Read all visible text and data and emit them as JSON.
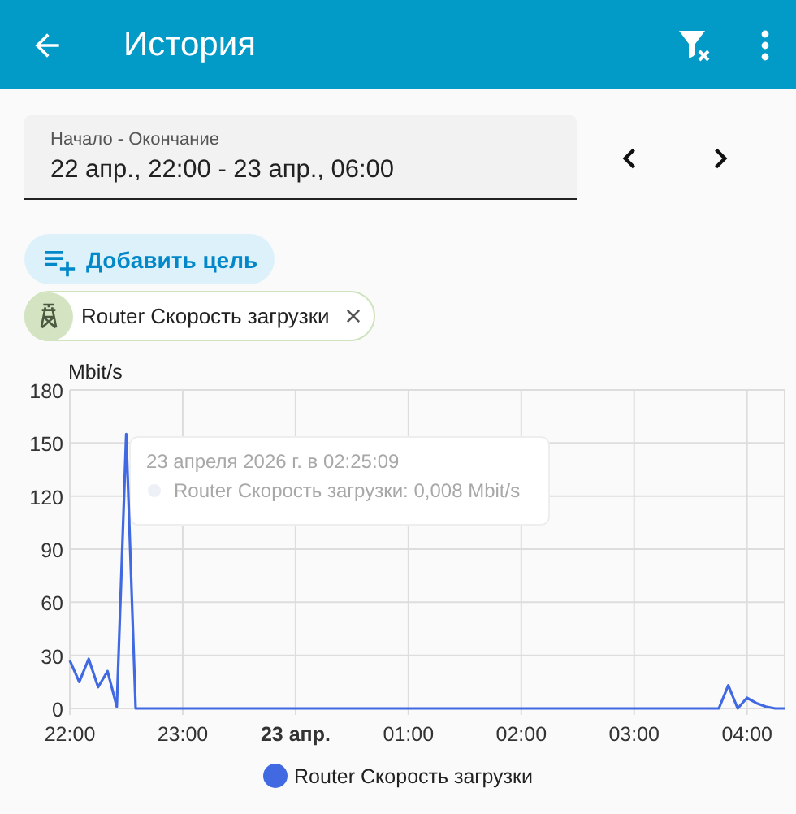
{
  "app_bar": {
    "title": "История"
  },
  "date_range": {
    "label": "Начало - Окончание",
    "value": "22 апр., 22:00 - 23 апр., 06:00"
  },
  "add_target_button": {
    "label": "Добавить цель"
  },
  "targets": [
    {
      "label": "Router Скорость загрузки"
    }
  ],
  "chart": {
    "tooltip": {
      "title": "23 апреля 2026 г. в 02:25:09",
      "line": "Router Скорость загрузки: 0,008 Mbit/s"
    },
    "chart_data": {
      "type": "line",
      "ylabel": "Mbit/s",
      "categories": [
        "22:00",
        null,
        null,
        null,
        null,
        null,
        null,
        null,
        null,
        null,
        null,
        null,
        "23:00",
        null,
        null,
        null,
        null,
        null,
        null,
        null,
        null,
        null,
        null,
        null,
        "23 апр.",
        null,
        null,
        null,
        null,
        null,
        null,
        null,
        null,
        null,
        null,
        null,
        "01:00",
        null,
        null,
        null,
        null,
        null,
        null,
        null,
        null,
        null,
        null,
        null,
        "02:00",
        null,
        null,
        null,
        null,
        null,
        null,
        null,
        null,
        null,
        null,
        null,
        "03:00",
        null,
        null,
        null,
        null,
        null,
        null,
        null,
        null,
        null,
        null,
        null,
        "04:00",
        null,
        null,
        null,
        null
      ],
      "series": [
        {
          "name": "Router Скорость загрузки",
          "color": "#4169e1",
          "values": [
            27,
            15,
            28,
            12,
            21,
            1,
            155,
            0,
            0,
            0,
            0,
            0,
            0,
            0,
            0,
            0,
            0,
            0,
            0,
            0,
            0,
            0,
            0,
            0,
            0,
            0,
            0,
            0,
            0,
            0,
            0,
            0,
            0,
            0,
            0,
            0,
            0,
            0,
            0,
            0,
            0,
            0,
            0,
            0,
            0,
            0,
            0,
            0,
            0,
            0,
            0,
            0,
            0,
            0,
            0,
            0,
            0,
            0,
            0,
            0,
            0,
            0,
            0,
            0,
            0,
            0,
            0,
            0,
            0,
            0,
            13,
            0,
            6,
            3,
            1,
            0,
            0
          ]
        }
      ],
      "ylim": [
        0,
        180
      ],
      "grid": true,
      "yticks": [
        0,
        30,
        60,
        90,
        120,
        150,
        180
      ]
    }
  }
}
